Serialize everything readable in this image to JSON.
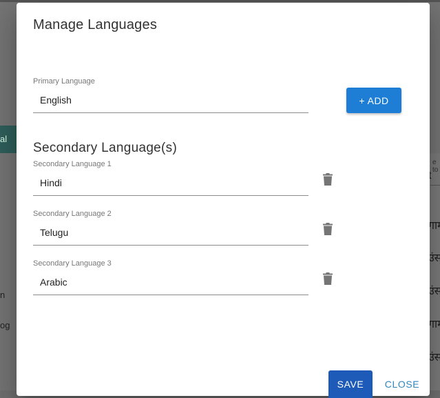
{
  "background": {
    "tab_text": "al",
    "left_texts": [
      "n",
      "og"
    ],
    "right_small": "e to",
    "right_input": "t",
    "right_texts": [
      "गाम",
      "उंस",
      "उंस",
      "गाम",
      "उंस"
    ]
  },
  "dialog": {
    "title": "Manage Languages",
    "primary": {
      "label": "Primary Language",
      "value": "English"
    },
    "add_label": "+ ADD",
    "secondary_title": "Secondary Language(s)",
    "secondary": [
      {
        "label": "Secondary Language 1",
        "value": "Hindi"
      },
      {
        "label": "Secondary Language 2",
        "value": "Telugu"
      },
      {
        "label": "Secondary Language 3",
        "value": "Arabic"
      }
    ],
    "save_label": "SAVE",
    "close_label": "CLOSE"
  },
  "icons": {
    "delete": "trash-icon"
  },
  "colors": {
    "add_button": "#1e7ed6",
    "save_button": "#1e5bb8",
    "close_text": "#2e86c1"
  }
}
